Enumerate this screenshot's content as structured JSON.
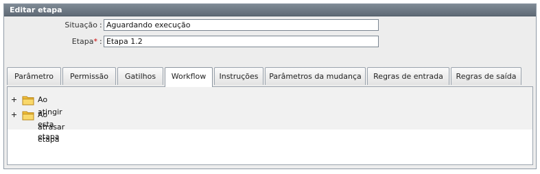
{
  "panel": {
    "title": "Editar etapa"
  },
  "form": {
    "situacao_label": "Situação",
    "situacao_value": "Aguardando execução",
    "etapa_label": "Etapa",
    "required_marker": "*",
    "etapa_value": "Etapa 1.2",
    "colon": ":"
  },
  "tabs": [
    {
      "label": "Parâmetro"
    },
    {
      "label": "Permissão"
    },
    {
      "label": "Gatilhos"
    },
    {
      "label": "Workflow"
    },
    {
      "label": "Instruções"
    },
    {
      "label": "Parâmetros da mudança"
    },
    {
      "label": "Regras de entrada"
    },
    {
      "label": "Regras de saída"
    }
  ],
  "active_tab": "Workflow",
  "tree": {
    "items": [
      {
        "label": "Ao atingir esta etapa",
        "icon": "folder-icon"
      },
      {
        "label": "Ao atrasar etapa",
        "icon": "folder-icon"
      }
    ]
  },
  "colors": {
    "title_bar": "#6f7a86",
    "panel_bg": "#ededed",
    "folder": "#f5c542"
  }
}
